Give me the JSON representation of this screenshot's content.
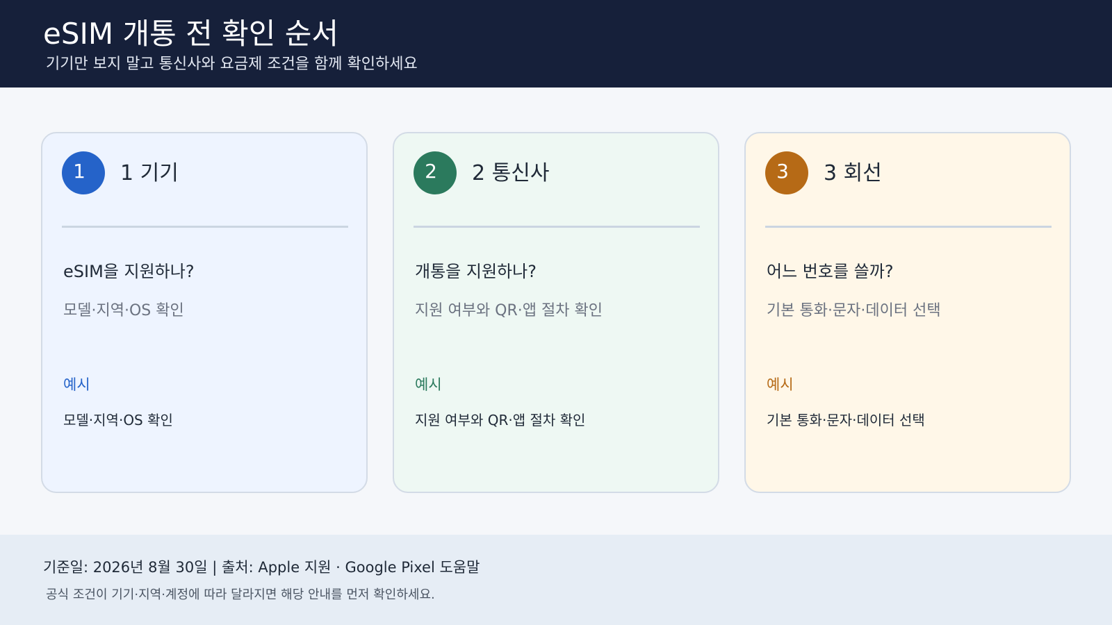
{
  "header": {
    "title": "eSIM 개통 전 확인 순서",
    "subtitle": "기기만 보지 말고 통신사와 요금제 조건을 함께 확인하세요"
  },
  "steps": [
    {
      "number": "1",
      "title": "1 기기",
      "question": "eSIM을 지원하나?",
      "detail": "모델·지역·OS 확인",
      "example_label": "예시",
      "example_text": "모델·지역·OS 확인",
      "color": "#2563c9"
    },
    {
      "number": "2",
      "title": "2 통신사",
      "question": "개통을 지원하나?",
      "detail": "지원 여부와 QR·앱 절차 확인",
      "example_label": "예시",
      "example_text": "지원 여부와 QR·앱 절차 확인",
      "color": "#2b7a5d"
    },
    {
      "number": "3",
      "title": "3 회선",
      "question": "어느 번호를 쓸까?",
      "detail": "기본 통화·문자·데이터 선택",
      "example_label": "예시",
      "example_text": "기본 통화·문자·데이터 선택",
      "color": "#b66a16"
    }
  ],
  "footer": {
    "meta": "기준일: 2026년 8월 30일  |  출처: Apple 지원 · Google Pixel 도움말",
    "note": "공식 조건이 기기·지역·계정에 따라 달라지면 해당 안내를 먼저 확인하세요."
  }
}
